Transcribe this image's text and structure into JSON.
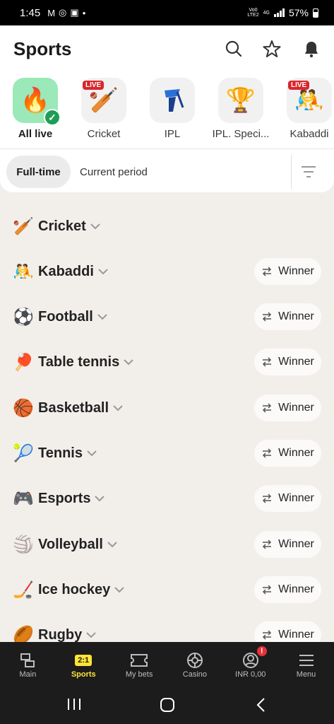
{
  "status": {
    "time": "1:45",
    "lte_top": "Vo0",
    "lte_bottom": "LTE2",
    "net": "4G",
    "battery": "57%"
  },
  "header": {
    "title": "Sports"
  },
  "sports_carousel": [
    {
      "label": "All live",
      "icon": "fire-icon",
      "live": false,
      "active": true
    },
    {
      "label": "Cricket",
      "icon": "cricket-icon",
      "live": true,
      "active": false
    },
    {
      "label": "IPL",
      "icon": "ipl-batsman-icon",
      "live": false,
      "active": false
    },
    {
      "label": "IPL. Speci...",
      "icon": "trophy-icon",
      "live": false,
      "active": false
    },
    {
      "label": "Kabaddi",
      "icon": "kabaddi-icon",
      "live": true,
      "active": false
    }
  ],
  "live_badge": "LIVE",
  "period": {
    "active": "Full-time",
    "other": "Current period"
  },
  "sports_list": [
    {
      "name": "Cricket",
      "emoji": "🏏",
      "winner": null
    },
    {
      "name": "Kabaddi",
      "emoji": "🤼",
      "winner": "Winner"
    },
    {
      "name": "Football",
      "emoji": "⚽",
      "winner": "Winner"
    },
    {
      "name": "Table tennis",
      "emoji": "🏓",
      "winner": "Winner"
    },
    {
      "name": "Basketball",
      "emoji": "🏀",
      "winner": "Winner"
    },
    {
      "name": "Tennis",
      "emoji": "🎾",
      "winner": "Winner"
    },
    {
      "name": "Esports",
      "emoji": "🎮",
      "winner": "Winner"
    },
    {
      "name": "Volleyball",
      "emoji": "🏐",
      "winner": "Winner"
    },
    {
      "name": "Ice hockey",
      "emoji": "🏒",
      "winner": "Winner"
    },
    {
      "name": "Rugby",
      "emoji": "🏉",
      "winner": "Winner"
    }
  ],
  "bottom_nav": [
    {
      "label": "Main",
      "icon": "layers-icon",
      "active": false
    },
    {
      "label": "Sports",
      "icon": "scoreboard-icon",
      "badge": "2:1",
      "active": true
    },
    {
      "label": "My bets",
      "icon": "ticket-icon",
      "active": false
    },
    {
      "label": "Casino",
      "icon": "roulette-icon",
      "active": false
    },
    {
      "label": "INR 0,00",
      "icon": "account-icon",
      "alert": "!",
      "active": false
    },
    {
      "label": "Menu",
      "icon": "hamburger-icon",
      "active": false
    }
  ],
  "colors": {
    "accent": "#ffe437",
    "live": "#d9262c",
    "active_chip": "#9be8b8",
    "check": "#1e9e55",
    "nav_bg": "#1c1c1c"
  }
}
